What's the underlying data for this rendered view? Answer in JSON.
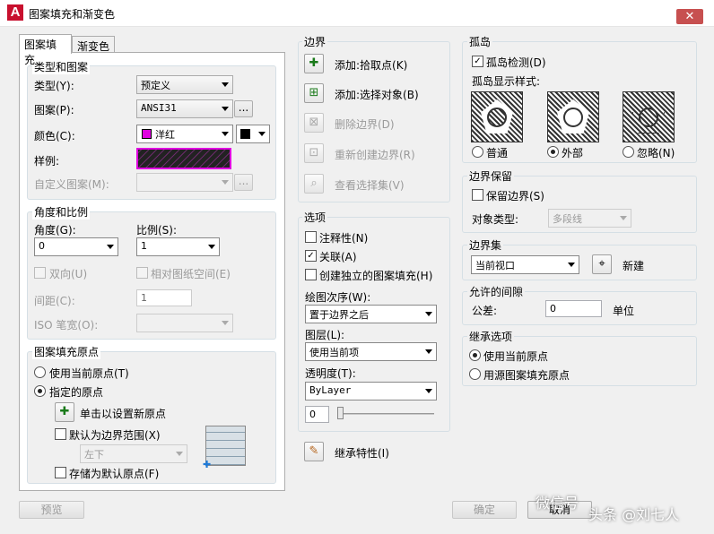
{
  "window": {
    "title": "图案填充和渐变色",
    "close": "✕",
    "logo": "A"
  },
  "tabs": [
    "图案填充",
    "渐变色"
  ],
  "type_pattern": {
    "legend": "类型和图案",
    "type_label": "类型(Y):",
    "type_value": "预定义",
    "pattern_label": "图案(P):",
    "pattern_value": "ANSI31",
    "browse": "...",
    "color_label": "颜色(C):",
    "color_value": "洋红",
    "color_swatch": "#e000e0",
    "bg_swatch": "#000000",
    "sample_label": "样例:",
    "custom_label": "自定义图案(M):"
  },
  "angle_scale": {
    "legend": "角度和比例",
    "angle_label": "角度(G):",
    "angle_value": "0",
    "scale_label": "比例(S):",
    "scale_value": "1",
    "double_label": "双向(U)",
    "relative_label": "相对图纸空间(E)",
    "spacing_label": "间距(C):",
    "spacing_value": "1",
    "iso_label": "ISO 笔宽(O):"
  },
  "origin": {
    "legend": "图案填充原点",
    "use_current": "使用当前原点(T)",
    "specified": "指定的原点",
    "click_set": "单击以设置新原点",
    "default_extent": "默认为边界范围(X)",
    "extent_value": "左下",
    "store_default": "存储为默认原点(F)"
  },
  "boundaries": {
    "legend": "边界",
    "add_pick": "添加:拾取点(K)",
    "add_select": "添加:选择对象(B)",
    "remove": "删除边界(D)",
    "recreate": "重新创建边界(R)",
    "view": "查看选择集(V)"
  },
  "options": {
    "legend": "选项",
    "annotative": "注释性(N)",
    "associative": "关联(A)",
    "separate": "创建独立的图案填充(H)",
    "draw_order_label": "绘图次序(W):",
    "draw_order_value": "置于边界之后",
    "layer_label": "图层(L):",
    "layer_value": "使用当前项",
    "transparency_label": "透明度(T):",
    "transparency_value": "ByLayer",
    "transparency_amount": "0"
  },
  "inherit": {
    "label": "继承特性(I)"
  },
  "islands": {
    "legend": "孤岛",
    "detect": "孤岛检测(D)",
    "style_label": "孤岛显示样式:",
    "normal": "普通",
    "outer": "外部",
    "ignore": "忽略(N)"
  },
  "retain": {
    "legend": "边界保留",
    "retain_label": "保留边界(S)",
    "obj_type_label": "对象类型:",
    "obj_type_value": "多段线"
  },
  "boundary_set": {
    "legend": "边界集",
    "value": "当前视口",
    "new_label": "新建"
  },
  "gap": {
    "legend": "允许的间隙",
    "tolerance_label": "公差:",
    "tolerance_value": "0",
    "unit": "单位"
  },
  "inherit_opts": {
    "legend": "继承选项",
    "use_current": "使用当前原点",
    "use_source": "用源图案填充原点"
  },
  "footer": {
    "preview": "预览",
    "ok": "确定",
    "cancel": "取消"
  },
  "watermark": {
    "text1": "微信号",
    "text2": "头条 @刘七人"
  }
}
